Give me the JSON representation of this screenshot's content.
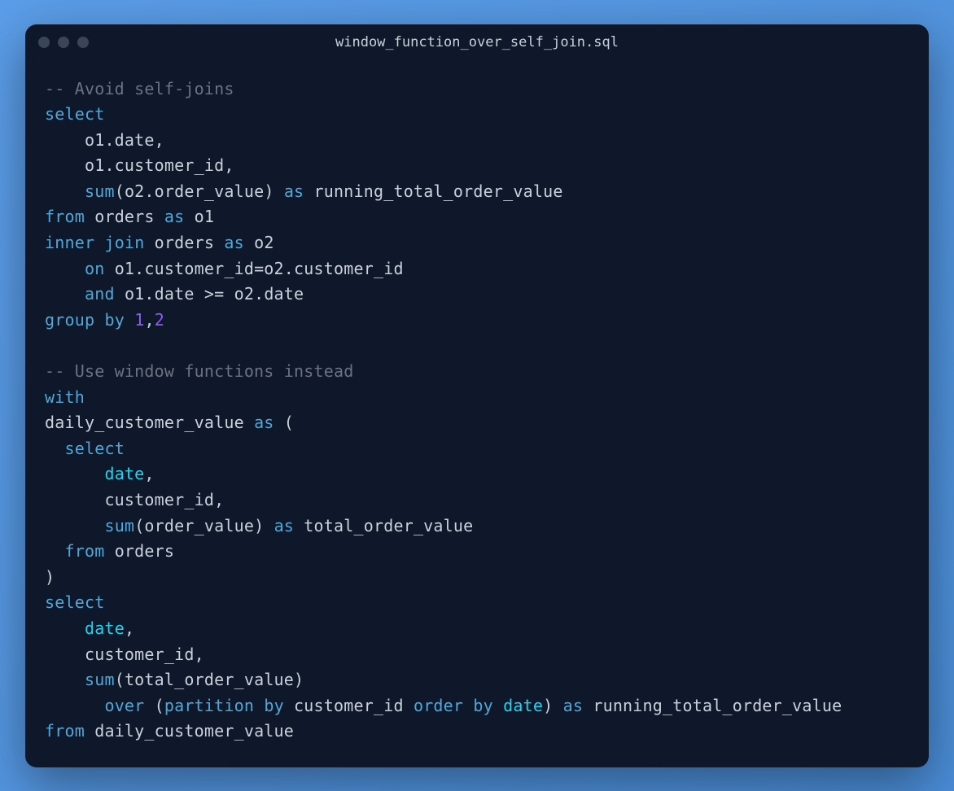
{
  "window": {
    "title": "window_function_over_self_join.sql"
  },
  "code": {
    "tokens": [
      [
        [
          "comment",
          "-- Avoid self-joins"
        ]
      ],
      [
        [
          "keyword",
          "select"
        ]
      ],
      [
        [
          "identifier",
          "    o1.date,"
        ]
      ],
      [
        [
          "identifier",
          "    o1.customer_id,"
        ]
      ],
      [
        [
          "identifier",
          "    "
        ],
        [
          "function",
          "sum"
        ],
        [
          "punct",
          "(o2.order_value) "
        ],
        [
          "keyword",
          "as"
        ],
        [
          "identifier",
          " running_total_order_value"
        ]
      ],
      [
        [
          "keyword",
          "from"
        ],
        [
          "identifier",
          " orders "
        ],
        [
          "keyword",
          "as"
        ],
        [
          "identifier",
          " o1"
        ]
      ],
      [
        [
          "keyword",
          "inner"
        ],
        [
          "identifier",
          " "
        ],
        [
          "keyword",
          "join"
        ],
        [
          "identifier",
          " orders "
        ],
        [
          "keyword",
          "as"
        ],
        [
          "identifier",
          " o2"
        ]
      ],
      [
        [
          "identifier",
          "    "
        ],
        [
          "keyword",
          "on"
        ],
        [
          "identifier",
          " o1.customer_id=o2.customer_id"
        ]
      ],
      [
        [
          "identifier",
          "    "
        ],
        [
          "keyword",
          "and"
        ],
        [
          "identifier",
          " o1.date >= o2.date"
        ]
      ],
      [
        [
          "keyword",
          "group"
        ],
        [
          "identifier",
          " "
        ],
        [
          "keyword",
          "by"
        ],
        [
          "identifier",
          " "
        ],
        [
          "number",
          "1"
        ],
        [
          "identifier",
          ","
        ],
        [
          "number",
          "2"
        ]
      ],
      [
        [
          "identifier",
          ""
        ]
      ],
      [
        [
          "comment",
          "-- Use window functions instead"
        ]
      ],
      [
        [
          "keyword",
          "with"
        ]
      ],
      [
        [
          "identifier",
          "daily_customer_value "
        ],
        [
          "keyword",
          "as"
        ],
        [
          "identifier",
          " ("
        ]
      ],
      [
        [
          "identifier",
          "  "
        ],
        [
          "keyword",
          "select"
        ]
      ],
      [
        [
          "identifier",
          "      "
        ],
        [
          "datetype",
          "date"
        ],
        [
          "identifier",
          ","
        ]
      ],
      [
        [
          "identifier",
          "      customer_id,"
        ]
      ],
      [
        [
          "identifier",
          "      "
        ],
        [
          "function",
          "sum"
        ],
        [
          "punct",
          "(order_value) "
        ],
        [
          "keyword",
          "as"
        ],
        [
          "identifier",
          " total_order_value"
        ]
      ],
      [
        [
          "identifier",
          "  "
        ],
        [
          "keyword",
          "from"
        ],
        [
          "identifier",
          " orders"
        ]
      ],
      [
        [
          "identifier",
          ")"
        ]
      ],
      [
        [
          "keyword",
          "select"
        ]
      ],
      [
        [
          "identifier",
          "    "
        ],
        [
          "datetype",
          "date"
        ],
        [
          "identifier",
          ","
        ]
      ],
      [
        [
          "identifier",
          "    customer_id,"
        ]
      ],
      [
        [
          "identifier",
          "    "
        ],
        [
          "function",
          "sum"
        ],
        [
          "punct",
          "(total_order_value)"
        ]
      ],
      [
        [
          "identifier",
          "      "
        ],
        [
          "keyword",
          "over"
        ],
        [
          "identifier",
          " ("
        ],
        [
          "keyword",
          "partition"
        ],
        [
          "identifier",
          " "
        ],
        [
          "keyword",
          "by"
        ],
        [
          "identifier",
          " customer_id "
        ],
        [
          "keyword",
          "order"
        ],
        [
          "identifier",
          " "
        ],
        [
          "keyword",
          "by"
        ],
        [
          "identifier",
          " "
        ],
        [
          "datetype",
          "date"
        ],
        [
          "identifier",
          ") "
        ],
        [
          "keyword",
          "as"
        ],
        [
          "identifier",
          " running_total_order_value"
        ]
      ],
      [
        [
          "keyword",
          "from"
        ],
        [
          "identifier",
          " daily_customer_value"
        ]
      ]
    ]
  }
}
